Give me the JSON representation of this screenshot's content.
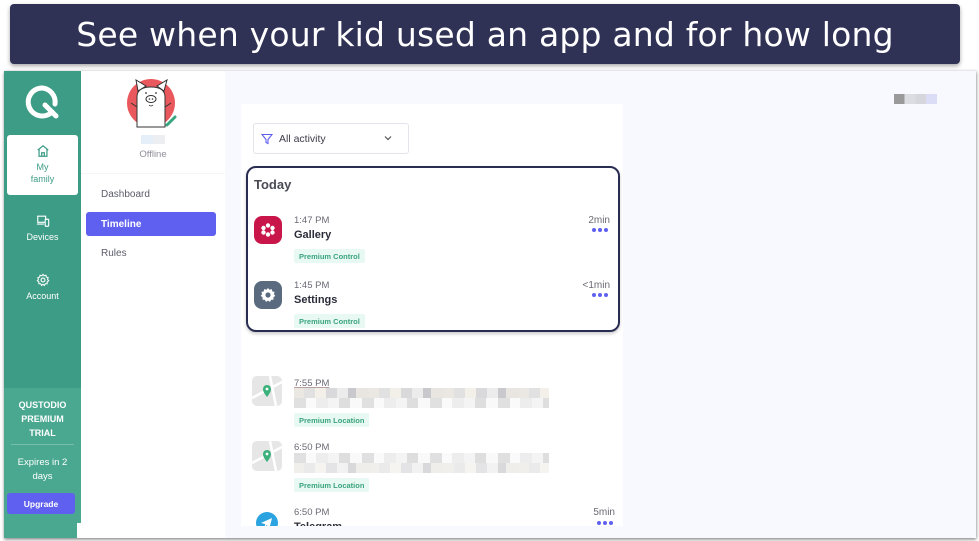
{
  "banner": {
    "text": "See when your kid used an app and for how long"
  },
  "rail": {
    "items": [
      {
        "label_line1": "My",
        "label_line2": "family",
        "icon": "home-icon",
        "active": true
      },
      {
        "label": "Devices",
        "icon": "devices-icon"
      },
      {
        "label": "Account",
        "icon": "gear-icon"
      }
    ],
    "trial": {
      "title_line1": "QUSTODIO",
      "title_line2": "PREMIUM",
      "title_line3": "TRIAL",
      "expires_line1": "Expires in 2",
      "expires_line2": "days",
      "upgrade_label": "Upgrade"
    }
  },
  "profile": {
    "status": "Offline"
  },
  "nav": {
    "items": [
      {
        "label": "Dashboard"
      },
      {
        "label": "Timeline",
        "active": true
      },
      {
        "label": "Rules"
      }
    ]
  },
  "timeline": {
    "filter": {
      "icon": "filter-icon",
      "value": "All activity"
    },
    "today_title": "Today",
    "today_entries": [
      {
        "time": "1:47 PM",
        "app": "Gallery",
        "badge": "Premium Control",
        "duration": "2min",
        "icon": "gallery-icon",
        "icon_color": "#c8154a"
      },
      {
        "time": "1:45 PM",
        "app": "Settings",
        "badge": "Premium Control",
        "duration": "<1min",
        "icon": "settings-icon",
        "icon_color": "#5a6b80"
      }
    ],
    "other_entries": [
      {
        "time": "7:55 PM",
        "badge": "Premium Location",
        "icon": "map-pin-icon"
      },
      {
        "time": "6:50 PM",
        "badge": "Premium Location",
        "icon": "map-pin-icon"
      },
      {
        "time": "6:50 PM",
        "app": "Telegram",
        "duration": "5min",
        "icon": "telegram-icon",
        "icon_color": "#2aa3e0"
      }
    ]
  },
  "colors": {
    "brand_green": "#3d9c85",
    "accent_purple": "#6060f0",
    "banner_navy": "#2f3155",
    "badge_green": "#3aa57f"
  }
}
